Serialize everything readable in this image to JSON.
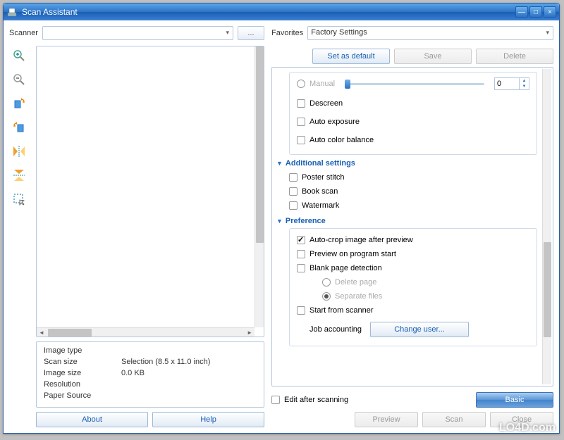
{
  "window": {
    "title": "Scan Assistant"
  },
  "left": {
    "scanner_label": "Scanner",
    "browse_label": "...",
    "info": {
      "image_type_lbl": "Image type",
      "image_type_val": "",
      "scan_size_lbl": "Scan size",
      "scan_size_val": "Selection (8.5 x 11.0 inch)",
      "image_size_lbl": "Image size",
      "image_size_val": "0.0 KB",
      "resolution_lbl": "Resolution",
      "resolution_val": "",
      "paper_source_lbl": "Paper Source",
      "paper_source_val": ""
    },
    "about": "About",
    "help": "Help"
  },
  "right": {
    "favorites_label": "Favorites",
    "favorites_value": "Factory Settings",
    "set_default": "Set as default",
    "save": "Save",
    "delete": "Delete",
    "manual_label": "Manual",
    "manual_value": "0",
    "descreen": "Descreen",
    "auto_exposure": "Auto exposure",
    "auto_color_balance": "Auto color balance",
    "additional_hdr": "Additional settings",
    "poster_stitch": "Poster stitch",
    "book_scan": "Book scan",
    "watermark_opt": "Watermark",
    "preference_hdr": "Preference",
    "auto_crop": "Auto-crop image after preview",
    "preview_start": "Preview on program start",
    "blank_page": "Blank page detection",
    "delete_page": "Delete page",
    "separate_files": "Separate files",
    "start_from_scanner": "Start from scanner",
    "job_accounting": "Job accounting",
    "change_user": "Change user...",
    "basic": "Basic",
    "edit_after": "Edit after scanning",
    "preview_btn": "Preview",
    "scan_btn": "Scan",
    "close_btn": "Close"
  },
  "watermark": "LO4D.com"
}
